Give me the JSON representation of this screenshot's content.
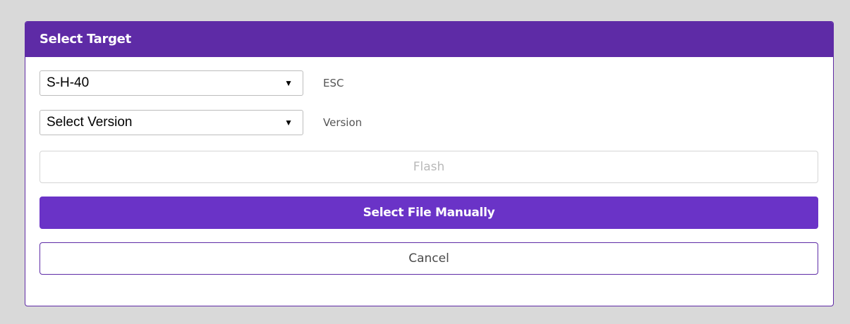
{
  "dialog": {
    "title": "Select Target",
    "esc_select": {
      "value": "S-H-40",
      "label": "ESC"
    },
    "version_select": {
      "value": "Select Version",
      "label": "Version"
    },
    "buttons": {
      "flash": "Flash",
      "select_manual": "Select File Manually",
      "cancel": "Cancel"
    },
    "dropdown_glyph": "▼"
  },
  "colors": {
    "accent": "#5e2ba6",
    "primary_button": "#6a33c7",
    "background": "#d9d9d9"
  }
}
